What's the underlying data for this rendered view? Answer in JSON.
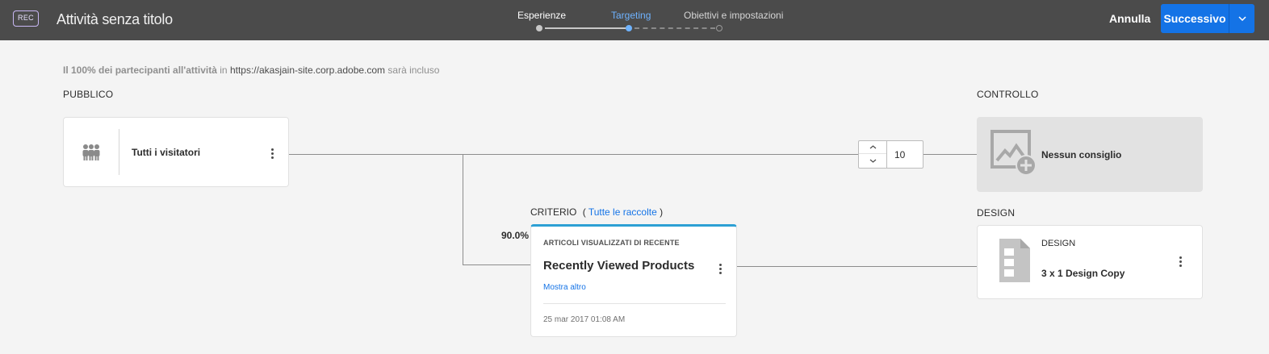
{
  "header": {
    "rec_badge": "REC",
    "title": "Attività senza titolo",
    "steps": [
      {
        "label": "Esperienze",
        "state": "done"
      },
      {
        "label": "Targeting",
        "state": "active"
      },
      {
        "label": "Obiettivi e impostazioni",
        "state": "todo"
      }
    ],
    "cancel_label": "Annulla",
    "next_label": "Successivo"
  },
  "summary": {
    "part1": "Il 100% dei partecipanti all'attività",
    "part2": "in",
    "url": "https://akasjain-site.corp.adobe.com",
    "part3": "sarà incluso"
  },
  "audience": {
    "section_label": "PUBBLICO",
    "card_title": "Tutti i visitatori",
    "icon": "people-icon"
  },
  "split": {
    "control_count": "10"
  },
  "control": {
    "section_label": "CONTROLLO",
    "card_title": "Nessun consiglio",
    "icon": "image-add-icon"
  },
  "criteria": {
    "section_label": "CRITERIO",
    "paren_open": "(",
    "collections_link": "Tutte le raccolte",
    "paren_close": ")",
    "percentage": "90.0%",
    "card_eyebrow": "ARTICOLI VISUALIZZATI DI RECENTE",
    "card_title": "Recently Viewed Products",
    "show_more": "Mostra altro",
    "timestamp": "25 mar 2017 01:08 AM",
    "accent_color": "#2da0d4"
  },
  "design": {
    "section_label": "DESIGN",
    "card_eyebrow": "DESIGN",
    "card_title": "3 x 1 Design Copy",
    "icon": "design-template-icon"
  },
  "colors": {
    "topbar": "#4b4b4b",
    "primary": "#1473e6",
    "active_step": "#6fb3ff",
    "background": "#f4f4f4"
  }
}
